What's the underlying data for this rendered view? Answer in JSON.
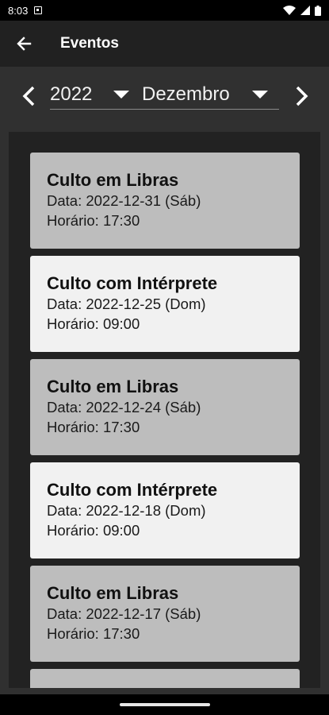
{
  "status_bar": {
    "time": "8:03"
  },
  "app_bar": {
    "title": "Eventos"
  },
  "selector": {
    "year": "2022",
    "month": "Dezembro"
  },
  "events": [
    {
      "title": "Culto em Libras",
      "date": "Data: 2022-12-31 (Sáb)",
      "time": "Horário: 17:30",
      "style": "gray"
    },
    {
      "title": "Culto com Intérprete",
      "date": "Data: 2022-12-25 (Dom)",
      "time": "Horário: 09:00",
      "style": "white"
    },
    {
      "title": "Culto em Libras",
      "date": "Data: 2022-12-24 (Sáb)",
      "time": "Horário: 17:30",
      "style": "gray"
    },
    {
      "title": "Culto com Intérprete",
      "date": "Data: 2022-12-18 (Dom)",
      "time": "Horário: 09:00",
      "style": "white"
    },
    {
      "title": "Culto em Libras",
      "date": "Data: 2022-12-17 (Sáb)",
      "time": "Horário: 17:30",
      "style": "gray"
    }
  ],
  "colors": {
    "card_gray": "#bdbdbd",
    "card_white": "#f1f1f1",
    "app_bar": "#212121",
    "background": "#303030"
  }
}
